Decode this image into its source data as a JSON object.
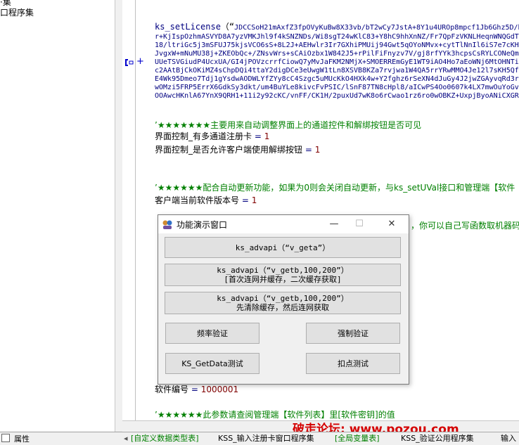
{
  "tree": {
    "item_top_partial": "·集",
    "item_program_set": "口程序集",
    "panel_tab_label": "属性"
  },
  "code": {
    "license_fn": "ks_setLicense",
    "license_open": "（“",
    "license_lines": [
      "JDCCSoH21mAxfZ3fpOVyKuBw8X33vb/bT2wCy7JstA+8Y1u4UROp8mpcf1Jb6Ghz5D/bC",
      "r+KjIspOzhmASVYD8A7yzVMKJhl9f4kSNZNDs/Wi8sgT24wKlC83+Y8hC9hhXnNZ/Fr7QpFzVKNLHeqnWNQGdTp",
      "18/ltriGc5j3mSFUJ75kjsVCO6sS+8L2J+AEHwlr3Ir7GXhiPMUij94Gwt5qOYoNMvx+cytTlNnIl6iS7e7cKH",
      "JvgxW+mNuMU38j+ZKEObQc+/ZNsvWrs+sCAiOzbx1W842J5+rPilFiFnyzv7V/gj8rfYYk3hcpsCsRYLCONeQm",
      "UUeTSVGiudP4UcxUA/GI4jPOVzcrrfCiowQ7yMvJaFKM2NMjX+SMOERREmGyE1WT9iAO4Ho7aEoWNj6MtOHNTil",
      "c2AAtBjCkOKiMZ4sChpDQi4ttaY2digDCe3eUwgW1tLn8XSVB8KZa7rvjwa1W4QA5rrYRwMMO4Je12l7sKH5Qfj",
      "E4Wk95Dmeo7Tdj1gYsdwAODWLYfZYy8cC4Szgc5uMUcKkO4HXk4w+Y2fghz6rSeXN4dJuGy4J2jwZGAyvqRd3r",
      "wOMzi5FRP5ErrX6GdkSy3dkt/um4BuYLe8kivcFvPSIC/lSnF87TN8cHpl8/aICwPS4Oo0607k4LX7mwOuYoGv",
      "OOAwcHKnlA67YnX9QRH1+11i2y92cKC/vnFF/CK1H/2puxUd7wK8o6rCwao1rz6ro0wOBKZ+UxpjByoANiCXGR"
    ],
    "comment1": "’★★★★★★★主要用来自动调整界面上的通道控件和解绑按钮是否可见",
    "var1_name": "界面控制_有多通道注册卡",
    "var1_value": "1",
    "var2_name": "界面控制_是否允许客户端使用解绑按钮",
    "var2_value": "1",
    "comment2": "’★★★★★★配合自动更新功能，如果为0则会关闭自动更新，与ks_setUVal接口和管理端【软件",
    "var3_name": "客户端当前软件版本号",
    "var3_value": "1",
    "comment3_tail": "，你可以自己写函数取机器码文",
    "var4_name": "软件编号",
    "var4_value": "1000001",
    "comment4": "’★★★★★★此参数请查阅管理端【软件列表】里[软件密钥]的值",
    "operator": "="
  },
  "dialog": {
    "title": "功能演示窗口",
    "minimize": "—",
    "maximize": "☐",
    "close": "✕",
    "btn1": "ks_advapi（“v_geta”）",
    "btn2_line1": "ks_advapi（“v_getb,100,200”）",
    "btn2_line2": "[首次连网并缓存，二次缓存获取]",
    "btn3_line1": "ks_advapi（“v_getb,100,200”）",
    "btn3_line2": "先清除缓存，然后连网获取",
    "btn_freq": "频率验证",
    "btn_force": "强制验证",
    "btn_getdata": "KS_GetData测试",
    "btn_deduct": "扣点测试"
  },
  "tabs": [
    "[自定义数据类型表]",
    "KSS_输入注册卡窗口程序集",
    "[全局变量表]",
    "KSS_验证公用程序集",
    "输入"
  ],
  "watermark": "破走论坛: www.pozou.com",
  "colors": {
    "comment": "#008000",
    "function": "#000080",
    "number": "#800000",
    "watermark": "#d40000"
  }
}
